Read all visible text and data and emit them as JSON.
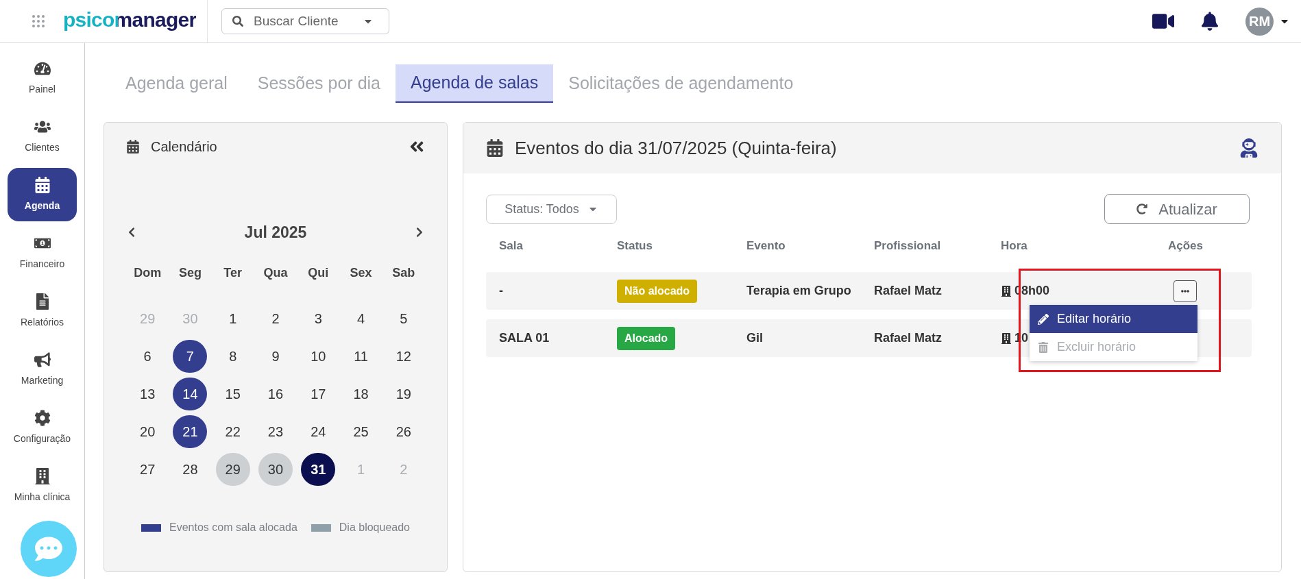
{
  "topbar": {
    "logo": "psicomanager",
    "search": {
      "placeholder": "Buscar Cliente"
    },
    "avatar": "RM"
  },
  "sidebar": {
    "items": [
      {
        "label": "Painel",
        "selected": false
      },
      {
        "label": "Clientes",
        "selected": false
      },
      {
        "label": "Agenda",
        "selected": true
      },
      {
        "label": "Financeiro",
        "selected": false
      },
      {
        "label": "Relatórios",
        "selected": false
      },
      {
        "label": "Marketing",
        "selected": false
      },
      {
        "label": "Configuração",
        "selected": false
      },
      {
        "label": "Minha clínica",
        "selected": false
      }
    ]
  },
  "tabs": [
    {
      "label": "Agenda geral",
      "selected": false
    },
    {
      "label": "Sessões por dia",
      "selected": false
    },
    {
      "label": "Agenda de salas",
      "selected": true
    },
    {
      "label": "Solicitações de agendamento",
      "selected": false
    }
  ],
  "calendar": {
    "title": "Calendário",
    "month": "Jul 2025",
    "weekdays": [
      "Dom",
      "Seg",
      "Ter",
      "Qua",
      "Qui",
      "Sex",
      "Sab"
    ],
    "weeks": [
      [
        {
          "label": "29",
          "kind": "muted"
        },
        {
          "label": "30",
          "kind": "muted"
        },
        {
          "label": "1",
          "kind": "normal"
        },
        {
          "label": "2",
          "kind": "normal"
        },
        {
          "label": "3",
          "kind": "normal"
        },
        {
          "label": "4",
          "kind": "normal"
        },
        {
          "label": "5",
          "kind": "normal"
        }
      ],
      [
        {
          "label": "6",
          "kind": "normal"
        },
        {
          "label": "7",
          "kind": "allocated"
        },
        {
          "label": "8",
          "kind": "normal"
        },
        {
          "label": "9",
          "kind": "normal"
        },
        {
          "label": "10",
          "kind": "normal"
        },
        {
          "label": "11",
          "kind": "normal"
        },
        {
          "label": "12",
          "kind": "normal"
        }
      ],
      [
        {
          "label": "13",
          "kind": "normal"
        },
        {
          "label": "14",
          "kind": "allocated"
        },
        {
          "label": "15",
          "kind": "normal"
        },
        {
          "label": "16",
          "kind": "normal"
        },
        {
          "label": "17",
          "kind": "normal"
        },
        {
          "label": "18",
          "kind": "normal"
        },
        {
          "label": "19",
          "kind": "normal"
        }
      ],
      [
        {
          "label": "20",
          "kind": "normal"
        },
        {
          "label": "21",
          "kind": "allocated"
        },
        {
          "label": "22",
          "kind": "normal"
        },
        {
          "label": "23",
          "kind": "normal"
        },
        {
          "label": "24",
          "kind": "normal"
        },
        {
          "label": "25",
          "kind": "normal"
        },
        {
          "label": "26",
          "kind": "normal"
        }
      ],
      [
        {
          "label": "27",
          "kind": "normal"
        },
        {
          "label": "28",
          "kind": "normal"
        },
        {
          "label": "29",
          "kind": "blocked"
        },
        {
          "label": "30",
          "kind": "blocked"
        },
        {
          "label": "31",
          "kind": "current"
        },
        {
          "label": "1",
          "kind": "muted"
        },
        {
          "label": "2",
          "kind": "muted"
        }
      ]
    ],
    "legend": [
      {
        "label": "Eventos com sala alocada",
        "color": "#343e8f"
      },
      {
        "label": "Dia bloqueado",
        "color": "#8fa0a8"
      }
    ]
  },
  "events": {
    "title": "Eventos do dia 31/07/2025 (Quinta-feira)",
    "filter": "Status: Todos",
    "refresh": "Atualizar",
    "columns": [
      "Sala",
      "Status",
      "Evento",
      "Profissional",
      "Hora",
      "Ações"
    ],
    "rows": [
      {
        "sala": "-",
        "status": "Não alocado",
        "color": "#cfb000",
        "evento": "Terapia em Grupo",
        "profissional": "Rafael Matz",
        "hora": "08h00",
        "menu_open": true
      },
      {
        "sala": "SALA 01",
        "status": "Alocado",
        "color": "#28a745",
        "evento": "Gil",
        "profissional": "Rafael Matz",
        "hora": "10",
        "menu_open": false
      }
    ],
    "menu": [
      {
        "label": "Editar horário",
        "selected": true,
        "disabled": false
      },
      {
        "label": "Excluir horário",
        "selected": false,
        "disabled": true
      }
    ]
  }
}
